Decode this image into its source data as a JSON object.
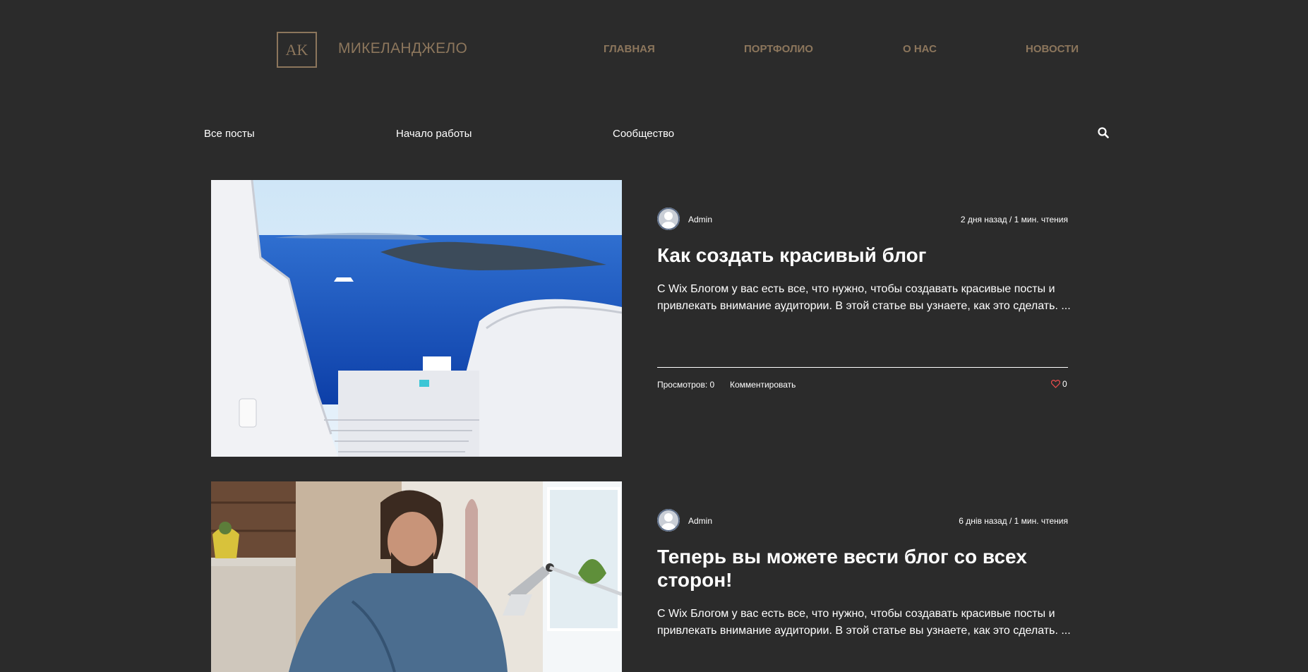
{
  "header": {
    "logo_initials": "AK",
    "site_name": "МИКЕЛАНДЖЕЛО",
    "nav": [
      "ГЛАВНАЯ",
      "ПОРТФОЛИО",
      "О НАС",
      "НОВОСТИ"
    ]
  },
  "blog_menu": {
    "categories": [
      "Все посты",
      "Начало работы",
      "Сообщество"
    ]
  },
  "posts": [
    {
      "author": "Admin",
      "meta": "2 дня назад / 1 мин. чтения",
      "title": "Как создать красивый блог",
      "excerpt": "С Wix Блогом у вас есть все, что нужно, чтобы создавать красивые посты и привлекать внимание аудитории. В этой статье вы узнаете, как это сделать. ...",
      "views": "Просмотров: 0",
      "comment": "Комментировать",
      "likes": "0"
    },
    {
      "author": "Admin",
      "meta": "6 днів назад / 1 мин. чтения",
      "title": "Теперь вы можете вести блог со всех сторон!",
      "excerpt": "С Wix Блогом у вас есть все, что нужно, чтобы создавать красивые посты и привлекать внимание аудитории. В этой статье вы узнаете, как это сделать. ..."
    }
  ],
  "colors": {
    "background": "#2b2b2b",
    "accent": "#8c765c",
    "text": "#ffffff",
    "like": "#e24b4b"
  }
}
